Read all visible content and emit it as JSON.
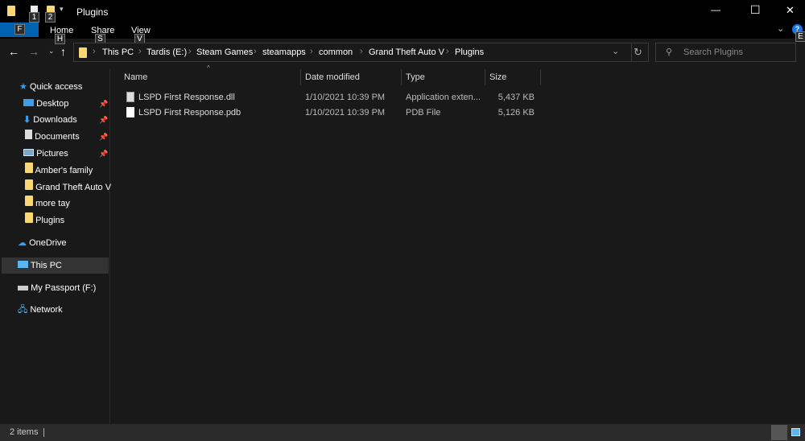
{
  "window": {
    "title": "Plugins",
    "qat_badges": [
      "1",
      "2"
    ],
    "minimize": "—",
    "maximize": "☐",
    "close": "✕"
  },
  "ribbon": {
    "file_key": "F",
    "tabs": [
      {
        "label": "Home",
        "key": "H"
      },
      {
        "label": "Share",
        "key": "S"
      },
      {
        "label": "View",
        "key": "V"
      }
    ],
    "help_key": "E"
  },
  "address": {
    "crumbs": [
      "This PC",
      "Tardis (E:)",
      "Steam Games",
      "steamapps",
      "common",
      "Grand Theft Auto V",
      "Plugins"
    ]
  },
  "search": {
    "placeholder": "Search Plugins"
  },
  "nav": {
    "quick_access": "Quick access",
    "pinned": [
      {
        "label": "Desktop",
        "icon": "desktop-icon"
      },
      {
        "label": "Downloads",
        "icon": "downloads-icon"
      },
      {
        "label": "Documents",
        "icon": "documents-icon"
      },
      {
        "label": "Pictures",
        "icon": "pictures-icon"
      }
    ],
    "folders": [
      "Amber's family",
      "Grand Theft Auto V",
      "more tay",
      "Plugins"
    ],
    "onedrive": "OneDrive",
    "this_pc": "This PC",
    "passport": "My Passport (F:)",
    "network": "Network"
  },
  "columns": [
    "Name",
    "Date modified",
    "Type",
    "Size"
  ],
  "files": [
    {
      "name": "LSPD First Response.dll",
      "date": "1/10/2021 10:39 PM",
      "type": "Application exten...",
      "size": "5,437 KB"
    },
    {
      "name": "LSPD First Response.pdb",
      "date": "1/10/2021 10:39 PM",
      "type": "PDB File",
      "size": "5,126 KB"
    }
  ],
  "status": {
    "count": "2 items"
  }
}
